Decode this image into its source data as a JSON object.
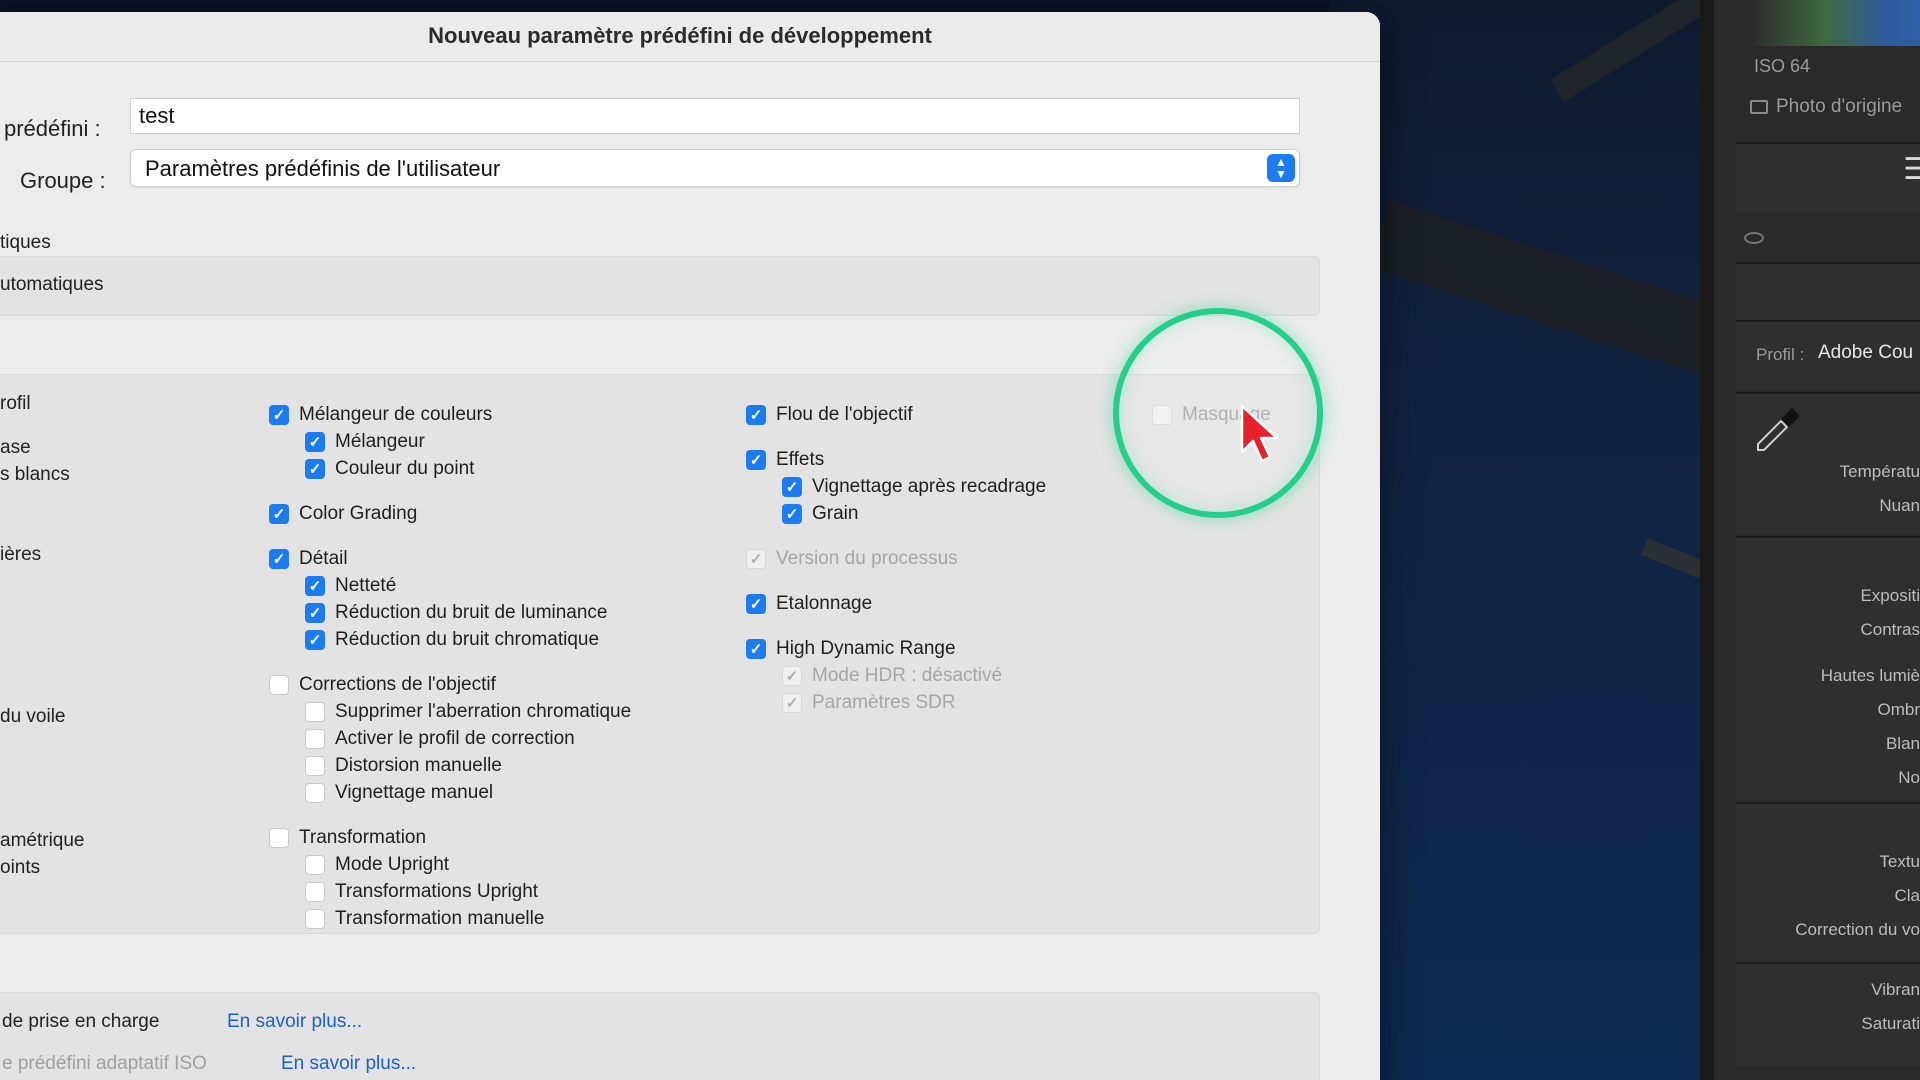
{
  "dialog": {
    "title": "Nouveau paramètre prédéfini de développement",
    "name_label": "prédéfini :",
    "name_value": "test",
    "group_label": "Groupe :",
    "group_value": "Paramètres prédéfinis de l'utilisateur",
    "section_partial_1": "tiques",
    "section_partial_2": "utomatiques",
    "left_labels": [
      "rofil",
      "ase",
      "s blancs",
      "ières",
      "du voile",
      "amétrique",
      "oints"
    ],
    "col1": [
      {
        "label": "Mélangeur de couleurs",
        "state": "on",
        "indent": 0
      },
      {
        "label": "Mélangeur",
        "state": "on",
        "indent": 1
      },
      {
        "label": "Couleur du point",
        "state": "on",
        "indent": 1
      },
      {
        "label": "Color Grading",
        "state": "on",
        "indent": 0
      },
      {
        "label": "Détail",
        "state": "on",
        "indent": 0
      },
      {
        "label": "Netteté",
        "state": "on",
        "indent": 1
      },
      {
        "label": "Réduction du bruit de luminance",
        "state": "on",
        "indent": 1
      },
      {
        "label": "Réduction du bruit chromatique",
        "state": "on",
        "indent": 1
      },
      {
        "label": "Corrections de l'objectif",
        "state": "off",
        "indent": 0
      },
      {
        "label": "Supprimer l'aberration chromatique",
        "state": "off",
        "indent": 1
      },
      {
        "label": "Activer le profil de correction",
        "state": "off",
        "indent": 1
      },
      {
        "label": "Distorsion manuelle",
        "state": "off",
        "indent": 1
      },
      {
        "label": "Vignettage manuel",
        "state": "off",
        "indent": 1
      },
      {
        "label": "Transformation",
        "state": "off",
        "indent": 0
      },
      {
        "label": "Mode Upright",
        "state": "off",
        "indent": 1
      },
      {
        "label": "Transformations Upright",
        "state": "off",
        "indent": 1
      },
      {
        "label": "Transformation manuelle",
        "state": "off",
        "indent": 1
      }
    ],
    "col2": [
      {
        "label": "Flou de l'objectif",
        "state": "on",
        "indent": 0
      },
      {
        "label": "Effets",
        "state": "on",
        "indent": 0
      },
      {
        "label": "Vignettage après recadrage",
        "state": "on",
        "indent": 1
      },
      {
        "label": "Grain",
        "state": "on",
        "indent": 1
      },
      {
        "label": "Version du processus",
        "state": "dis",
        "indent": 0
      },
      {
        "label": "Etalonnage",
        "state": "on",
        "indent": 0
      },
      {
        "label": "High Dynamic Range",
        "state": "on",
        "indent": 0
      },
      {
        "label": "Mode HDR : désactivé",
        "state": "dis",
        "indent": 1
      },
      {
        "label": "Paramètres SDR",
        "state": "dis",
        "indent": 1
      }
    ],
    "col3": [
      {
        "label": "Masquage",
        "state": "dis",
        "indent": 0
      }
    ],
    "footer_text_1": "de prise en charge",
    "footer_link_1": "En savoir plus...",
    "footer_text_2": "e prédéfini adaptatif ISO",
    "footer_link_2": "En savoir plus..."
  },
  "right_panel": {
    "iso": "ISO 64",
    "original_photo": "Photo d'origine",
    "profile_label": "Profil :",
    "profile_value": "Adobe Cou",
    "labels": [
      "Températu",
      "Nuan",
      "Expositi",
      "Contras",
      "Hautes lumiè",
      "Ombr",
      "Blan",
      "No",
      "Textu",
      "Cla",
      "Correction du vo",
      "Vibran",
      "Saturati"
    ]
  },
  "colors": {
    "accent": "#1a7cf0",
    "highlight_ring": "#23d08b",
    "cursor": "#e8202a",
    "link": "#1a5fd0"
  }
}
